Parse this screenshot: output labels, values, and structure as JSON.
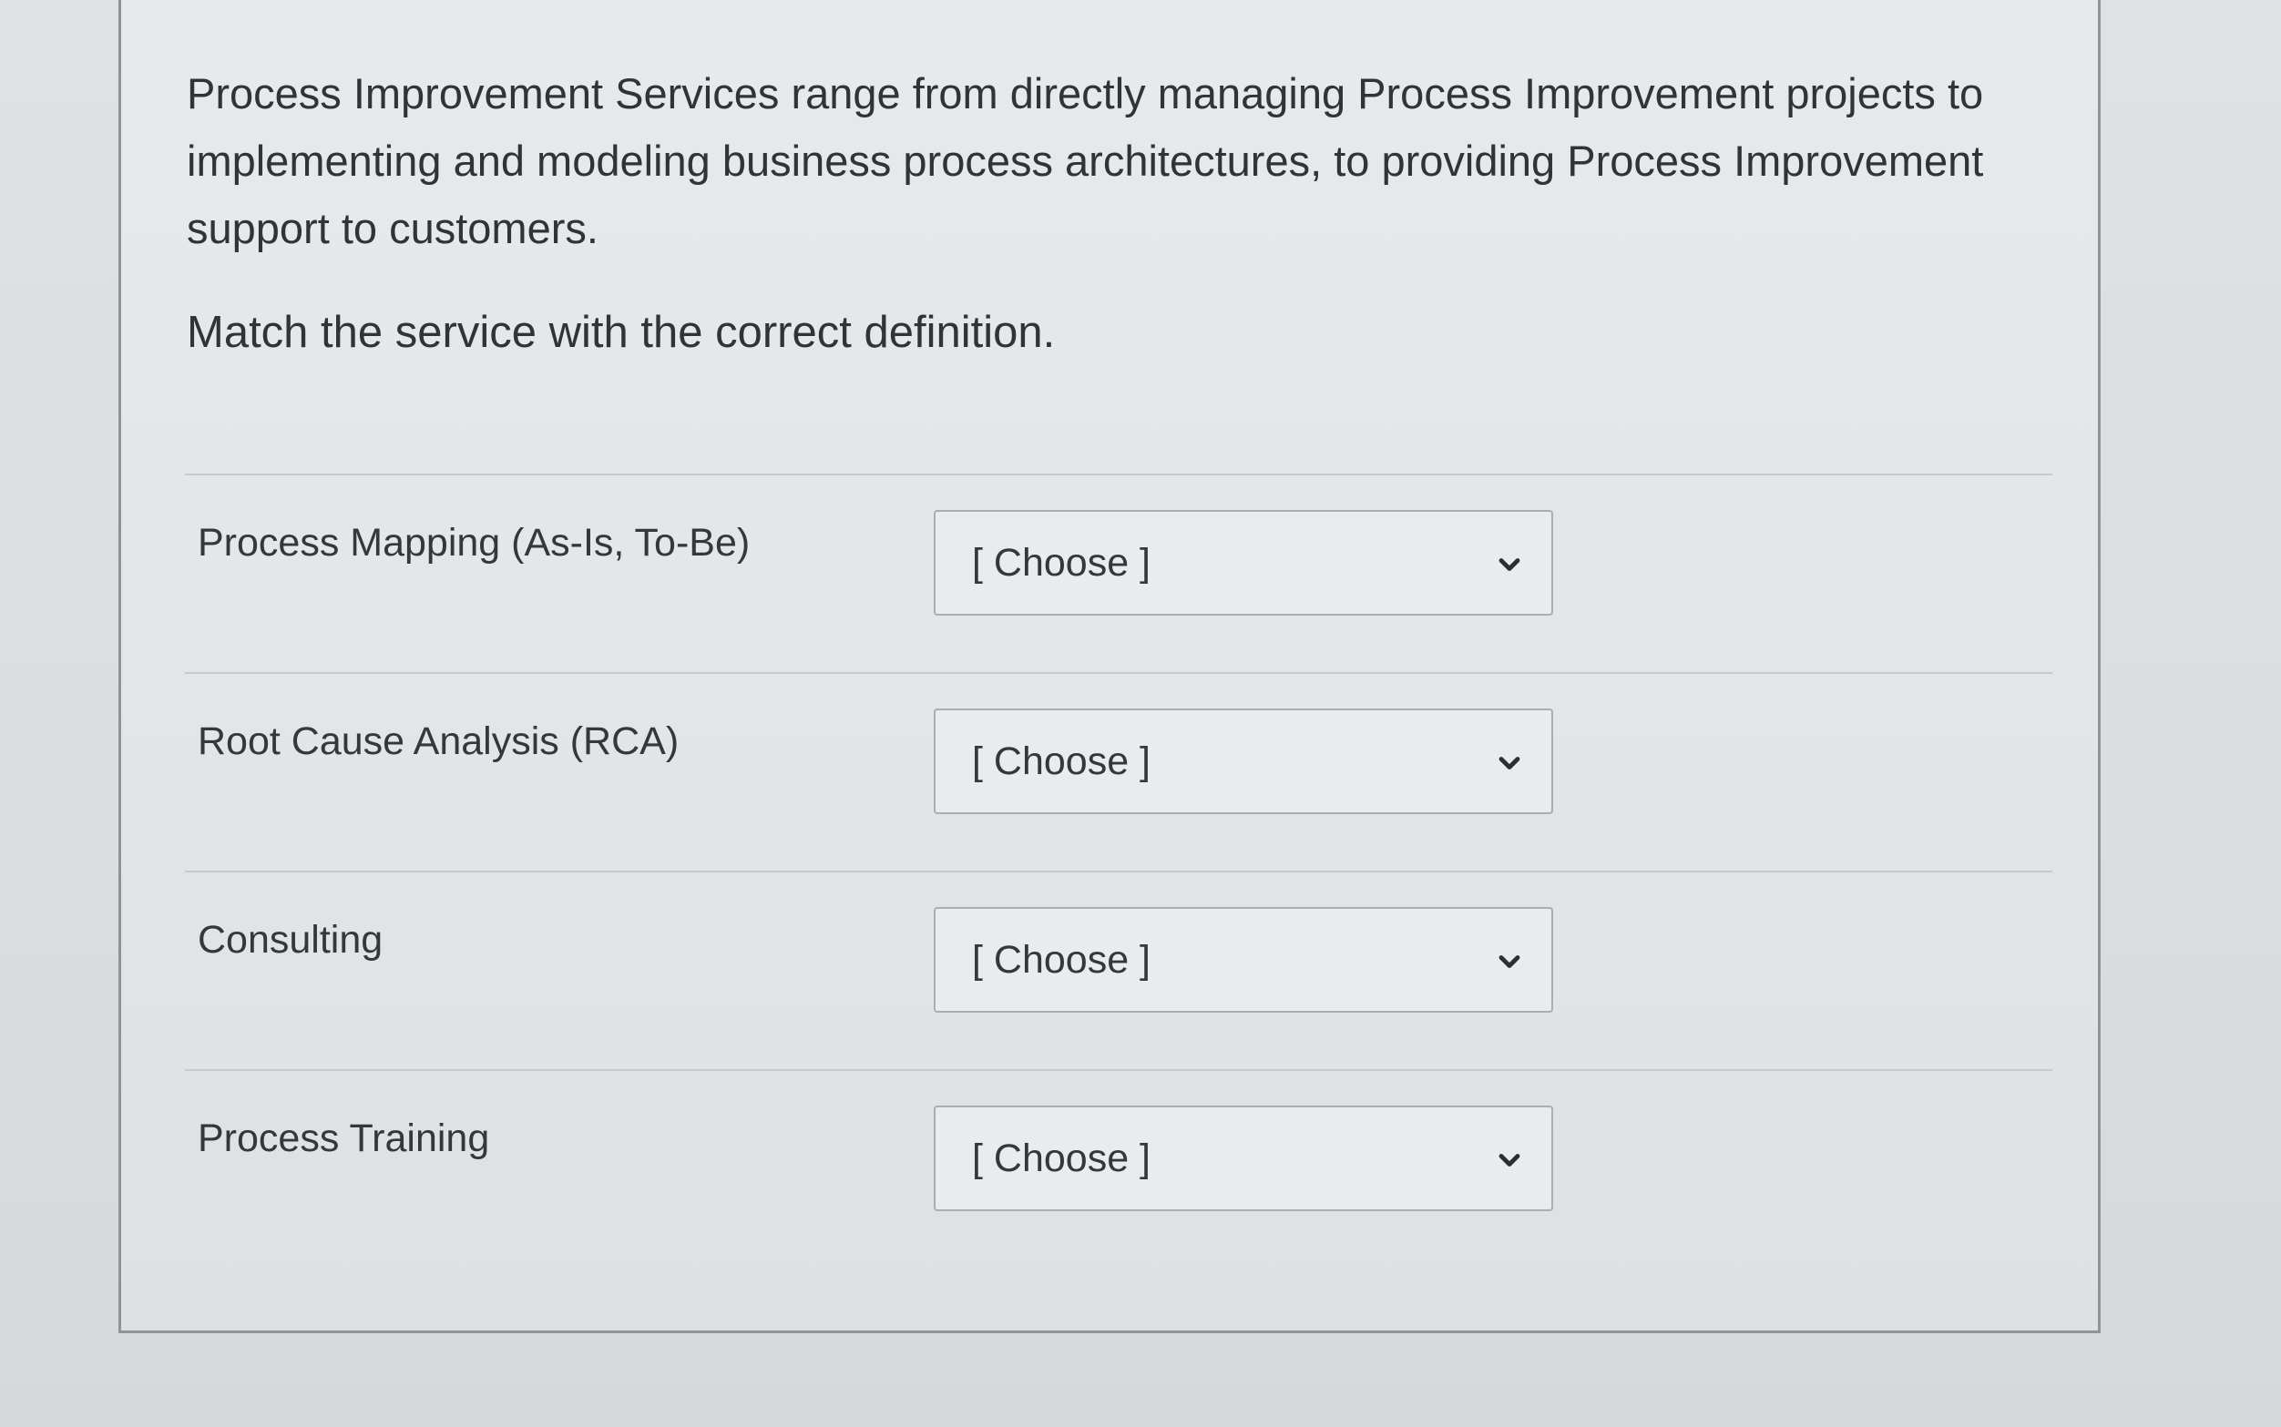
{
  "question": {
    "text": "Process Improvement Services range from directly managing Process Improvement projects to implementing and modeling business process architectures, to providing Process Improvement support to customers.",
    "instruction": "Match the service with the correct definition."
  },
  "matches": [
    {
      "prompt": "Process Mapping (As-Is, To-Be)",
      "selected": "[ Choose ]"
    },
    {
      "prompt": "Root Cause Analysis (RCA)",
      "selected": "[ Choose ]"
    },
    {
      "prompt": "Consulting",
      "selected": "[ Choose ]"
    },
    {
      "prompt": "Process Training",
      "selected": "[ Choose ]"
    }
  ],
  "icons": {
    "dropdown": "chevron-down-icon"
  }
}
